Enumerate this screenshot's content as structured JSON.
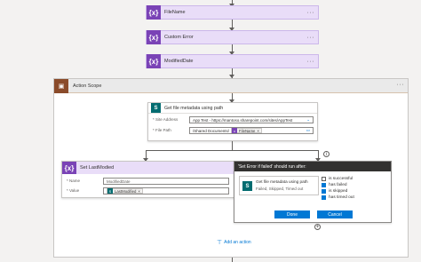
{
  "top_cards": [
    {
      "icon": "{x}",
      "label": "FileName"
    },
    {
      "icon": "{x}",
      "label": "Custom Error"
    },
    {
      "icon": "{x}",
      "label": "ModifiedDate"
    }
  ],
  "card_menu": "···",
  "scope": {
    "title": "Action Scope",
    "menu": "···"
  },
  "metadata_card": {
    "icon": "S",
    "title": "Get file metadata using path",
    "site_label": "* Site Address",
    "site_value": "App Test - https://mantoso.sharepoint.com/sites/AppTest",
    "path_label": "* File Path",
    "path_value": "/Shared Documents/",
    "path_token": "FileName"
  },
  "set_card": {
    "icon": "{x}",
    "title": "Set LastModied",
    "name_label": "* Name",
    "name_value": "ModifiedDate",
    "value_label": "* Value",
    "value_token": "LastModified"
  },
  "run_after": {
    "title": "'Set Error if failed' should run after:",
    "action_title": "Get file metadata using path",
    "action_status": "Failed, Skipped, Timed out",
    "options": [
      {
        "label": "is successful",
        "checked": false
      },
      {
        "label": "has failed",
        "checked": true
      },
      {
        "label": "is skipped",
        "checked": true
      },
      {
        "label": "has timed out",
        "checked": true
      }
    ],
    "done": "Done",
    "cancel": "Cancel"
  },
  "add_action": "Add an action",
  "colors": {
    "variable": "#7a43b6",
    "sharepoint": "#036c70",
    "accent": "#0078d4",
    "scope": "#8a4b2a"
  }
}
